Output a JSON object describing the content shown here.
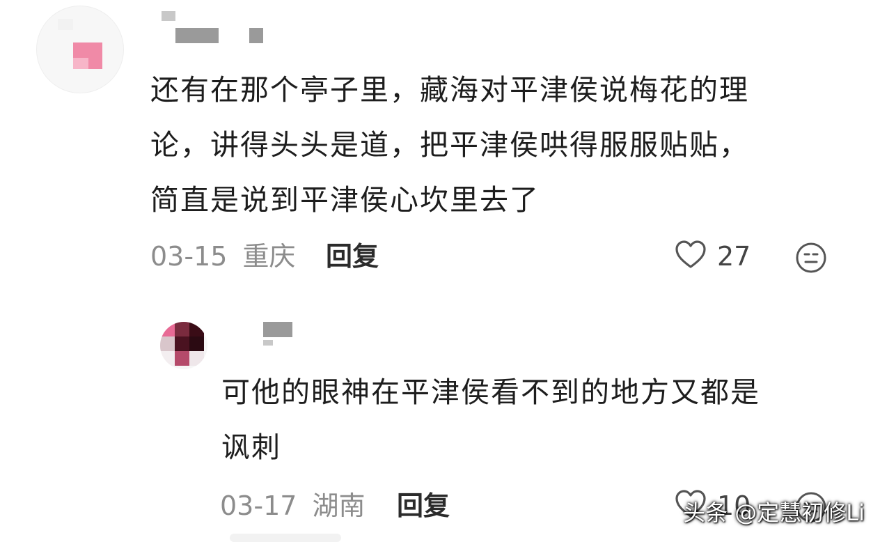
{
  "comment": {
    "text_lines": [
      "还有在那个亭子里，藏海对平津侯说梅花的理",
      "论，讲得头头是道，把平津侯哄得服服贴贴，",
      "简直是说到平津侯心坎里去了"
    ],
    "date": "03-15",
    "location": "重庆",
    "reply_label": "回复",
    "likes": "27",
    "like_icon": "heart-outline-icon",
    "emoji_icon": "emoji-face-icon"
  },
  "reply": {
    "text_lines": [
      "可他的眼神在平津侯看不到的地方又都是",
      "讽刺"
    ],
    "date": "03-17",
    "location": "湖南",
    "reply_label": "回复",
    "likes": "10"
  },
  "watermark": "头条 @定慧初修Li",
  "colors": {
    "text": "#1d1d1d",
    "meta": "#8c8c8c",
    "icon": "#555555"
  }
}
